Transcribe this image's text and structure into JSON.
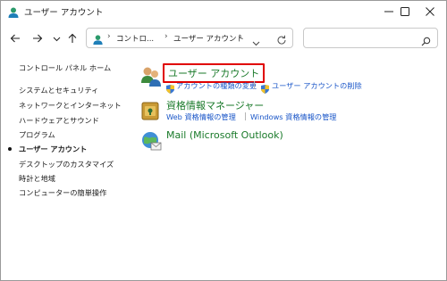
{
  "window": {
    "title": "ユーザー アカウント"
  },
  "toolbar": {
    "breadcrumb": [
      "コントロ...",
      "ユーザー アカウント"
    ]
  },
  "sidebar": {
    "items": [
      {
        "label": "コントロール パネル ホーム"
      },
      {
        "label": "システムとセキュリティ"
      },
      {
        "label": "ネットワークとインターネット"
      },
      {
        "label": "ハードウェアとサウンド"
      },
      {
        "label": "プログラム"
      },
      {
        "label": "ユーザー アカウント",
        "selected": true
      },
      {
        "label": "デスクトップのカスタマイズ"
      },
      {
        "label": "時計と地域"
      },
      {
        "label": "コンピューターの簡単操作"
      }
    ]
  },
  "main": {
    "categories": [
      {
        "title": "ユーザー アカウント",
        "icon": "user-accounts-icon",
        "links": [
          "アカウントの種類の変更",
          "ユーザー アカウントの削除"
        ]
      },
      {
        "title": "資格情報マネージャー",
        "icon": "credential-manager-icon",
        "links": [
          "Web 資格情報の管理",
          "Windows 資格情報の管理"
        ]
      },
      {
        "title": "Mail (Microsoft Outlook)",
        "icon": "mail-icon",
        "links": []
      }
    ]
  },
  "colors": {
    "category_title": "#1a7a2a",
    "link": "#1a56c8",
    "highlight_border": "#e00000"
  }
}
